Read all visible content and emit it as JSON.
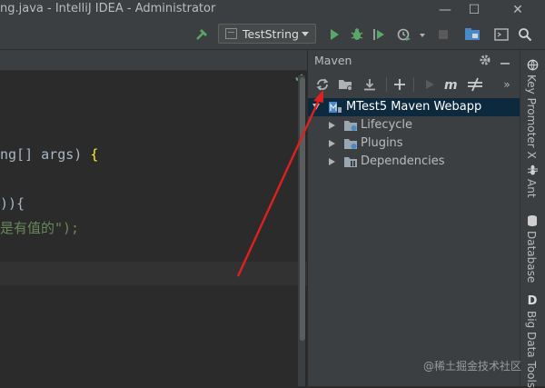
{
  "window": {
    "title": "ng.java - IntelliJ IDEA - Administrator",
    "minimize_glyph": "—",
    "maximize_glyph": "☐",
    "close_glyph": "✕"
  },
  "toolbar": {
    "run_config": "TestString"
  },
  "editor": {
    "lines": [
      {
        "text": "ng[] args) ",
        "brace": "{"
      },
      {
        "text": ")){"
      },
      {
        "text": "是有值的\");"
      }
    ]
  },
  "maven": {
    "title": "Maven",
    "more_glyph": "»",
    "tree": [
      {
        "label": "MTest5 Maven Webapp"
      },
      {
        "label": "Lifecycle"
      },
      {
        "label": "Plugins"
      },
      {
        "label": "Dependencies"
      }
    ]
  },
  "stripe": {
    "tools": [
      {
        "label": "Key Promoter X"
      },
      {
        "label": "Ant"
      },
      {
        "label": "Database"
      },
      {
        "label": "Big Data Tools"
      }
    ]
  },
  "watermark": "@稀土掘金技术社区",
  "colors": {
    "accent_green": "#59a869",
    "selection": "#0d293e",
    "annotation_arrow": "#e0201f"
  }
}
